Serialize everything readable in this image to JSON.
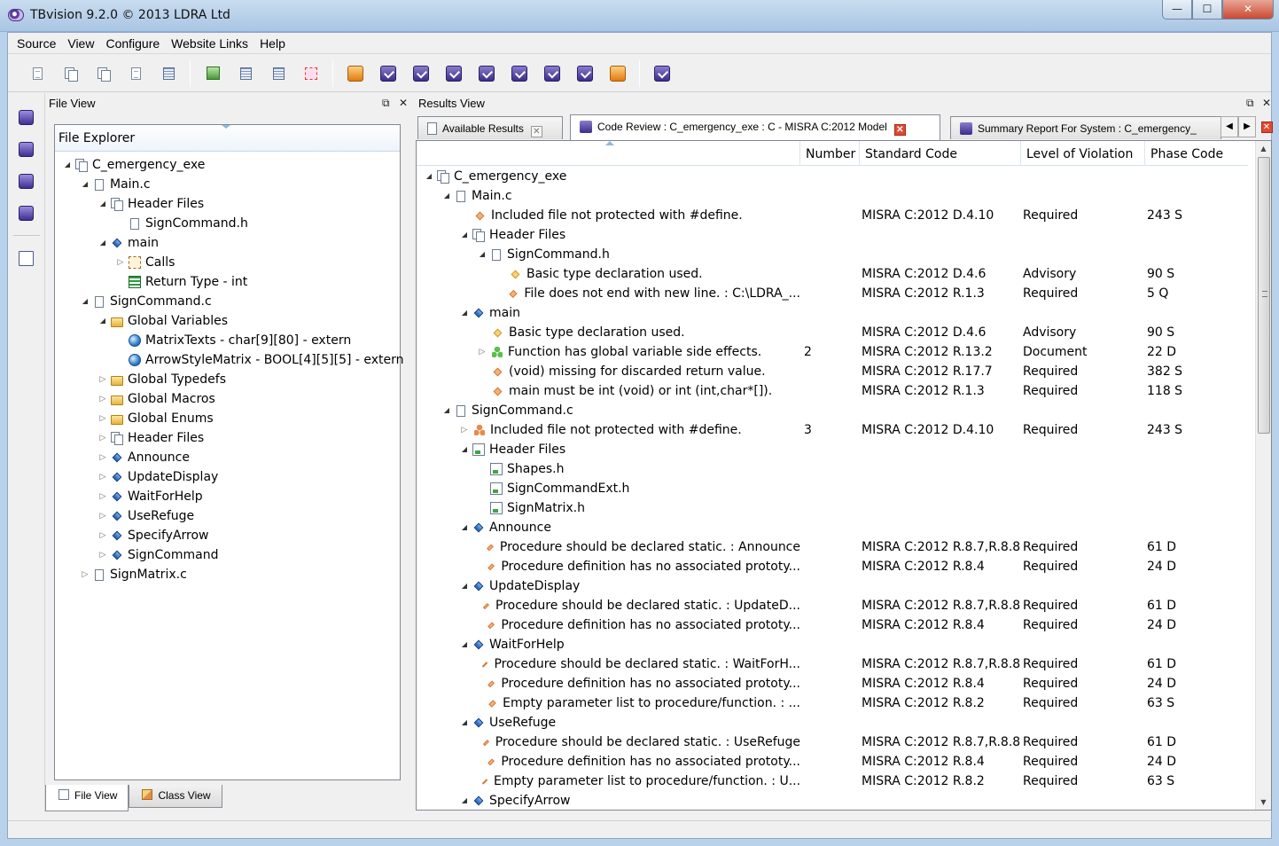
{
  "window": {
    "title": "TBvision 9.2.0 © 2013 LDRA Ltd",
    "min": "—",
    "max": "☐",
    "close": "✕"
  },
  "menu": [
    "Source",
    "View",
    "Configure",
    "Website Links",
    "Help"
  ],
  "file_view": {
    "panel_title": "File View",
    "explorer_title": "File Explorer",
    "tree": [
      {
        "label": "C_emergency_exe",
        "depth": 0,
        "arrow": "open",
        "icon": "files"
      },
      {
        "label": "Main.c",
        "depth": 1,
        "arrow": "open",
        "icon": "file"
      },
      {
        "label": "Header Files",
        "depth": 2,
        "arrow": "open",
        "icon": "files"
      },
      {
        "label": "SignCommand.h",
        "depth": 3,
        "arrow": "",
        "icon": "file"
      },
      {
        "label": "main",
        "depth": 2,
        "arrow": "open",
        "icon": "func"
      },
      {
        "label": "Calls",
        "depth": 3,
        "arrow": "closed",
        "icon": "calls"
      },
      {
        "label": "Return Type - int",
        "depth": 3,
        "arrow": "",
        "icon": "ret"
      },
      {
        "label": "SignCommand.c",
        "depth": 1,
        "arrow": "open",
        "icon": "file"
      },
      {
        "label": "Global Variables",
        "depth": 2,
        "arrow": "open",
        "icon": "folder"
      },
      {
        "label": "MatrixTexts - char[9][80] - extern",
        "depth": 3,
        "arrow": "",
        "icon": "globe"
      },
      {
        "label": "ArrowStyleMatrix - BOOL[4][5][5] - extern",
        "depth": 3,
        "arrow": "",
        "icon": "globe"
      },
      {
        "label": "Global Typedefs",
        "depth": 2,
        "arrow": "closed",
        "icon": "folder"
      },
      {
        "label": "Global Macros",
        "depth": 2,
        "arrow": "closed",
        "icon": "folder"
      },
      {
        "label": "Global Enums",
        "depth": 2,
        "arrow": "closed",
        "icon": "folder"
      },
      {
        "label": "Header Files",
        "depth": 2,
        "arrow": "closed",
        "icon": "files"
      },
      {
        "label": "Announce",
        "depth": 2,
        "arrow": "closed",
        "icon": "func"
      },
      {
        "label": "UpdateDisplay",
        "depth": 2,
        "arrow": "closed",
        "icon": "func"
      },
      {
        "label": "WaitForHelp",
        "depth": 2,
        "arrow": "closed",
        "icon": "func"
      },
      {
        "label": "UseRefuge",
        "depth": 2,
        "arrow": "closed",
        "icon": "func"
      },
      {
        "label": "SpecifyArrow",
        "depth": 2,
        "arrow": "closed",
        "icon": "func"
      },
      {
        "label": "SignCommand",
        "depth": 2,
        "arrow": "closed",
        "icon": "func"
      },
      {
        "label": "SignMatrix.c",
        "depth": 1,
        "arrow": "closed",
        "icon": "file"
      }
    ],
    "bottom_tabs": [
      "File View",
      "Class View"
    ]
  },
  "results_view": {
    "panel_title": "Results View",
    "tabs": [
      {
        "label": "Available Results",
        "active": false
      },
      {
        "label": "Code Review : C_emergency_exe : C - MISRA C:2012  Model",
        "active": true
      },
      {
        "label": "Summary Report For System : C_emergency_",
        "active": false
      }
    ],
    "columns": [
      "Number",
      "Standard Code",
      "Level of Violation",
      "Phase Code"
    ],
    "rows": [
      {
        "label": "C_emergency_exe",
        "depth": 0,
        "arrow": "open",
        "icon": "files",
        "number": "",
        "code": "",
        "level": "",
        "phase": ""
      },
      {
        "label": "Main.c",
        "depth": 1,
        "arrow": "open",
        "icon": "file",
        "number": "",
        "code": "",
        "level": "",
        "phase": ""
      },
      {
        "label": "Included file not protected with #define.",
        "depth": 2,
        "arrow": "",
        "icon": "diamond",
        "number": "",
        "code": "MISRA  C:2012 D.4.10",
        "level": "Required",
        "phase": "243 S"
      },
      {
        "label": "Header Files",
        "depth": 2,
        "arrow": "open",
        "icon": "files",
        "number": "",
        "code": "",
        "level": "",
        "phase": ""
      },
      {
        "label": "SignCommand.h",
        "depth": 3,
        "arrow": "open",
        "icon": "file",
        "number": "",
        "code": "",
        "level": "",
        "phase": ""
      },
      {
        "label": "Basic type declaration used.",
        "depth": 4,
        "arrow": "",
        "icon": "gold",
        "number": "",
        "code": "MISRA  C:2012 D.4.6",
        "level": "Advisory",
        "phase": "90 S"
      },
      {
        "label": "File does not end with new line. : C:\\LDRA_...",
        "depth": 4,
        "arrow": "",
        "icon": "diamond",
        "number": "",
        "code": "MISRA  C:2012 R.1.3",
        "level": "Required",
        "phase": "5 Q"
      },
      {
        "label": "main",
        "depth": 2,
        "arrow": "open",
        "icon": "func",
        "number": "",
        "code": "",
        "level": "",
        "phase": ""
      },
      {
        "label": "Basic type declaration used.",
        "depth": 3,
        "arrow": "",
        "icon": "gold",
        "number": "",
        "code": "MISRA  C:2012 D.4.6",
        "level": "Advisory",
        "phase": "90 S"
      },
      {
        "label": "Function has global variable side effects.",
        "depth": 3,
        "arrow": "closed",
        "icon": "cluster",
        "number": "2",
        "code": "MISRA  C:2012 R.13.2",
        "level": "Document",
        "phase": "22 D"
      },
      {
        "label": "(void) missing for discarded return value.",
        "depth": 3,
        "arrow": "",
        "icon": "diamond",
        "number": "",
        "code": "MISRA  C:2012 R.17.7",
        "level": "Required",
        "phase": "382 S"
      },
      {
        "label": "main must be int (void) or int (int,char*[]).",
        "depth": 3,
        "arrow": "",
        "icon": "diamond",
        "number": "",
        "code": "MISRA  C:2012 R.1.3",
        "level": "Required",
        "phase": "118 S"
      },
      {
        "label": "SignCommand.c",
        "depth": 1,
        "arrow": "open",
        "icon": "file",
        "number": "",
        "code": "",
        "level": "",
        "phase": ""
      },
      {
        "label": "Included file not protected with #define.",
        "depth": 2,
        "arrow": "closed",
        "icon": "cluster-orange",
        "number": "3",
        "code": "MISRA  C:2012 D.4.10",
        "level": "Required",
        "phase": "243 S"
      },
      {
        "label": "Header Files",
        "depth": 2,
        "arrow": "open",
        "icon": "hdr",
        "number": "",
        "code": "",
        "level": "",
        "phase": ""
      },
      {
        "label": "Shapes.h",
        "depth": 3,
        "arrow": "",
        "icon": "hdr",
        "number": "",
        "code": "",
        "level": "",
        "phase": ""
      },
      {
        "label": "SignCommandExt.h",
        "depth": 3,
        "arrow": "",
        "icon": "hdr",
        "number": "",
        "code": "",
        "level": "",
        "phase": ""
      },
      {
        "label": "SignMatrix.h",
        "depth": 3,
        "arrow": "",
        "icon": "hdr",
        "number": "",
        "code": "",
        "level": "",
        "phase": ""
      },
      {
        "label": "Announce",
        "depth": 2,
        "arrow": "open",
        "icon": "func",
        "number": "",
        "code": "",
        "level": "",
        "phase": ""
      },
      {
        "label": "Procedure should be declared static. : Announce",
        "depth": 3,
        "arrow": "",
        "icon": "diamond",
        "number": "",
        "code": "MISRA  C:2012 R.8.7,R.8.8",
        "level": "Required",
        "phase": "61 D"
      },
      {
        "label": "Procedure definition has no associated prototy...",
        "depth": 3,
        "arrow": "",
        "icon": "diamond",
        "number": "",
        "code": "MISRA  C:2012 R.8.4",
        "level": "Required",
        "phase": "24 D"
      },
      {
        "label": "UpdateDisplay",
        "depth": 2,
        "arrow": "open",
        "icon": "func",
        "number": "",
        "code": "",
        "level": "",
        "phase": ""
      },
      {
        "label": "Procedure should be declared static. : UpdateD...",
        "depth": 3,
        "arrow": "",
        "icon": "diamond",
        "number": "",
        "code": "MISRA  C:2012 R.8.7,R.8.8",
        "level": "Required",
        "phase": "61 D"
      },
      {
        "label": "Procedure definition has no associated prototy...",
        "depth": 3,
        "arrow": "",
        "icon": "diamond",
        "number": "",
        "code": "MISRA  C:2012 R.8.4",
        "level": "Required",
        "phase": "24 D"
      },
      {
        "label": "WaitForHelp",
        "depth": 2,
        "arrow": "open",
        "icon": "func",
        "number": "",
        "code": "",
        "level": "",
        "phase": ""
      },
      {
        "label": "Procedure should be declared static. : WaitForH...",
        "depth": 3,
        "arrow": "",
        "icon": "diamond",
        "number": "",
        "code": "MISRA  C:2012 R.8.7,R.8.8",
        "level": "Required",
        "phase": "61 D"
      },
      {
        "label": "Procedure definition has no associated prototy...",
        "depth": 3,
        "arrow": "",
        "icon": "diamond",
        "number": "",
        "code": "MISRA  C:2012 R.8.4",
        "level": "Required",
        "phase": "24 D"
      },
      {
        "label": "Empty parameter list to procedure/function. : ...",
        "depth": 3,
        "arrow": "",
        "icon": "diamond",
        "number": "",
        "code": "MISRA  C:2012 R.8.2",
        "level": "Required",
        "phase": "63 S"
      },
      {
        "label": "UseRefuge",
        "depth": 2,
        "arrow": "open",
        "icon": "func",
        "number": "",
        "code": "",
        "level": "",
        "phase": ""
      },
      {
        "label": "Procedure should be declared static. : UseRefuge",
        "depth": 3,
        "arrow": "",
        "icon": "diamond",
        "number": "",
        "code": "MISRA  C:2012 R.8.7,R.8.8",
        "level": "Required",
        "phase": "61 D"
      },
      {
        "label": "Procedure definition has no associated prototy...",
        "depth": 3,
        "arrow": "",
        "icon": "diamond",
        "number": "",
        "code": "MISRA  C:2012 R.8.4",
        "level": "Required",
        "phase": "24 D"
      },
      {
        "label": "Empty parameter list to procedure/function. : U...",
        "depth": 3,
        "arrow": "",
        "icon": "diamond",
        "number": "",
        "code": "MISRA  C:2012 R.8.2",
        "level": "Required",
        "phase": "63 S"
      },
      {
        "label": "SpecifyArrow",
        "depth": 2,
        "arrow": "open",
        "icon": "func",
        "number": "",
        "code": "",
        "level": "",
        "phase": ""
      }
    ]
  }
}
